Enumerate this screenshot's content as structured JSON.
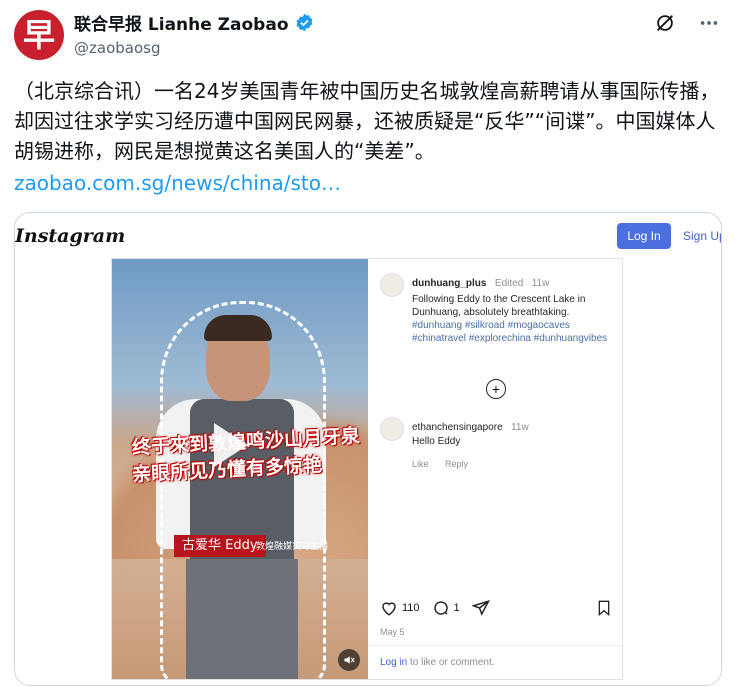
{
  "tweet": {
    "avatar_char": "早",
    "author_name": "联合早报 Lianhe Zaobao",
    "handle": "@zaobaosg",
    "text": "（北京综合讯）一名24岁美国青年被中国历史名城敦煌高薪聘请从事国际传播，却因过往求学实习经历遭中国网民网暴，还被质疑是“反华”“间谍”。中国媒体人胡锡进称，网民是想搅黄这名美国人的“美差”。",
    "link": "zaobao.com.sg/news/china/sto…",
    "icons": [
      "grok-icon",
      "more-icon"
    ]
  },
  "instagram": {
    "logo": "Instagram",
    "login_label": "Log In",
    "signup_label": "Sign Up",
    "video": {
      "caption_line1": "终于來到敦煌鸣沙山月牙泉",
      "caption_line2": "亲眼所见乃懂有多惊艳",
      "name_tag": "古爱华 Eddy",
      "name_subtitle": "敦煌融媒实习主播"
    },
    "post": {
      "username": "dunhuang_plus",
      "edited": "Edited",
      "age": "11w",
      "caption": "Following Eddy to the Crescent Lake in Dunhuang, absolutely breathtaking.",
      "hashtags": "#dunhuang #silkroad #mogaocaves #chinatravel #explorechina #dunhuangvibes"
    },
    "comment": {
      "username": "ethanchensingapore",
      "age": "11w",
      "text": "Hello Eddy",
      "like": "Like",
      "reply": "Reply"
    },
    "likes": "110",
    "comments": "1",
    "date": "May 5",
    "footer_login": "Log in",
    "footer_rest": " to like or comment."
  },
  "colors": {
    "brand_red": "#c8202c",
    "link_blue": "#1d9bf0",
    "ig_button": "#4c6fe0"
  }
}
